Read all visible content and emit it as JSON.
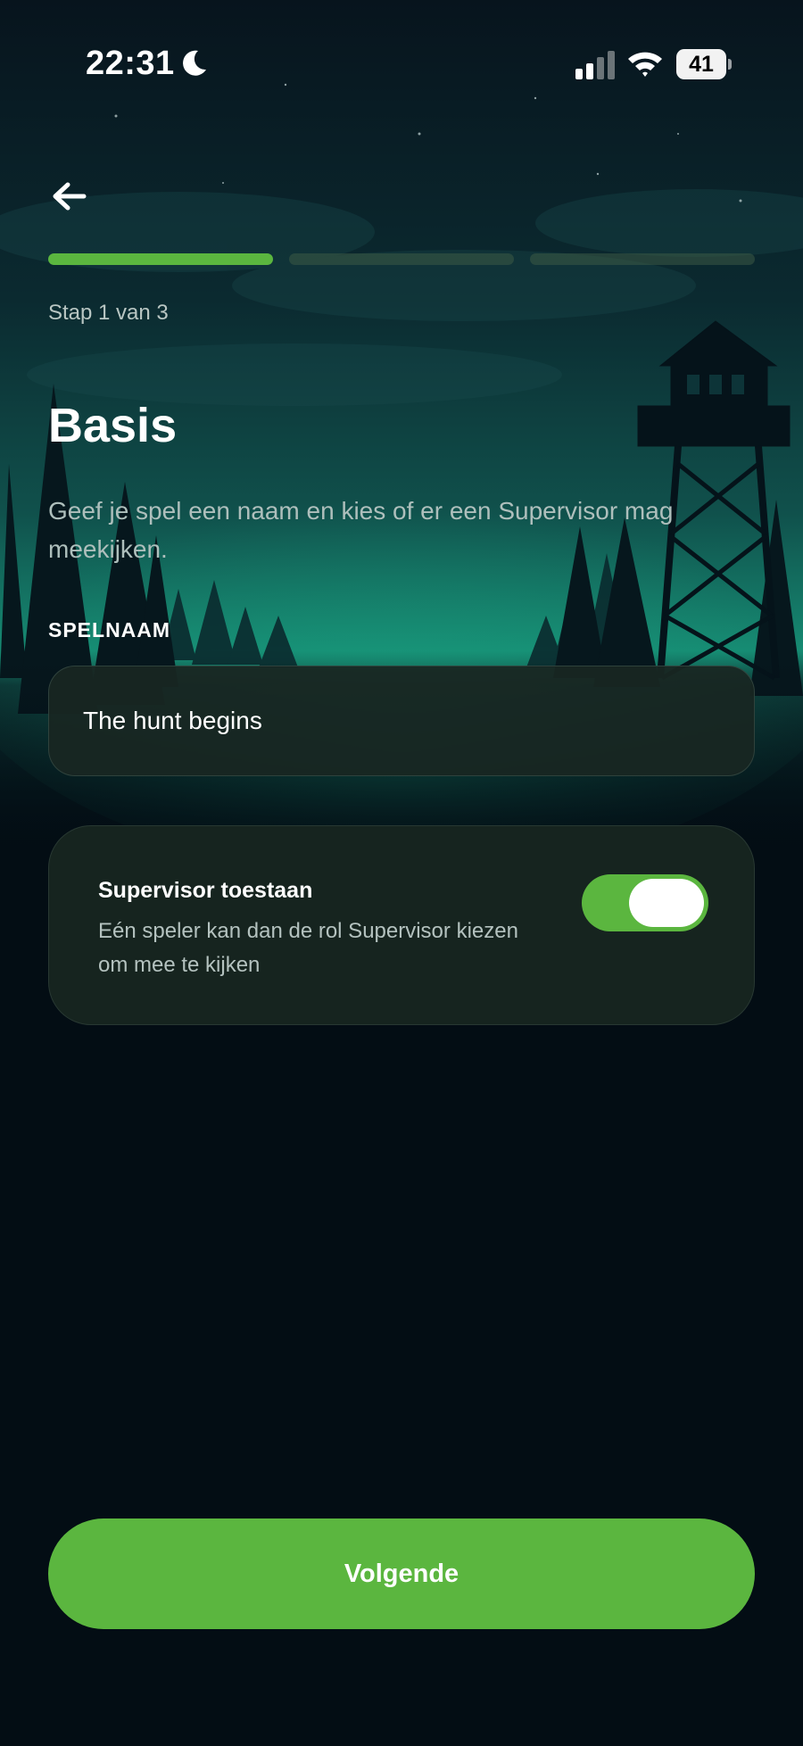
{
  "status_bar": {
    "time": "22:31",
    "battery": "41",
    "icons": [
      "moon-icon",
      "cellular-signal-icon",
      "wifi-icon",
      "battery-icon"
    ]
  },
  "header": {
    "back_icon": "arrow-left-icon"
  },
  "progress": {
    "current_step": 1,
    "total_steps": 3,
    "label": "Stap 1 van 3"
  },
  "page": {
    "title": "Basis",
    "description": "Geef je spel een naam en kies of er een Supervisor mag meekijken."
  },
  "game_name": {
    "label": "SPELNAAM",
    "value": "The hunt begins"
  },
  "supervisor": {
    "title": "Supervisor toestaan",
    "description": "Eén speler kan dan de rol Supervisor kiezen om mee te kijken",
    "enabled": true
  },
  "footer": {
    "next_label": "Volgende"
  },
  "colors": {
    "accent": "#5bb63f",
    "background": "#030d14",
    "card": "#16241f"
  }
}
